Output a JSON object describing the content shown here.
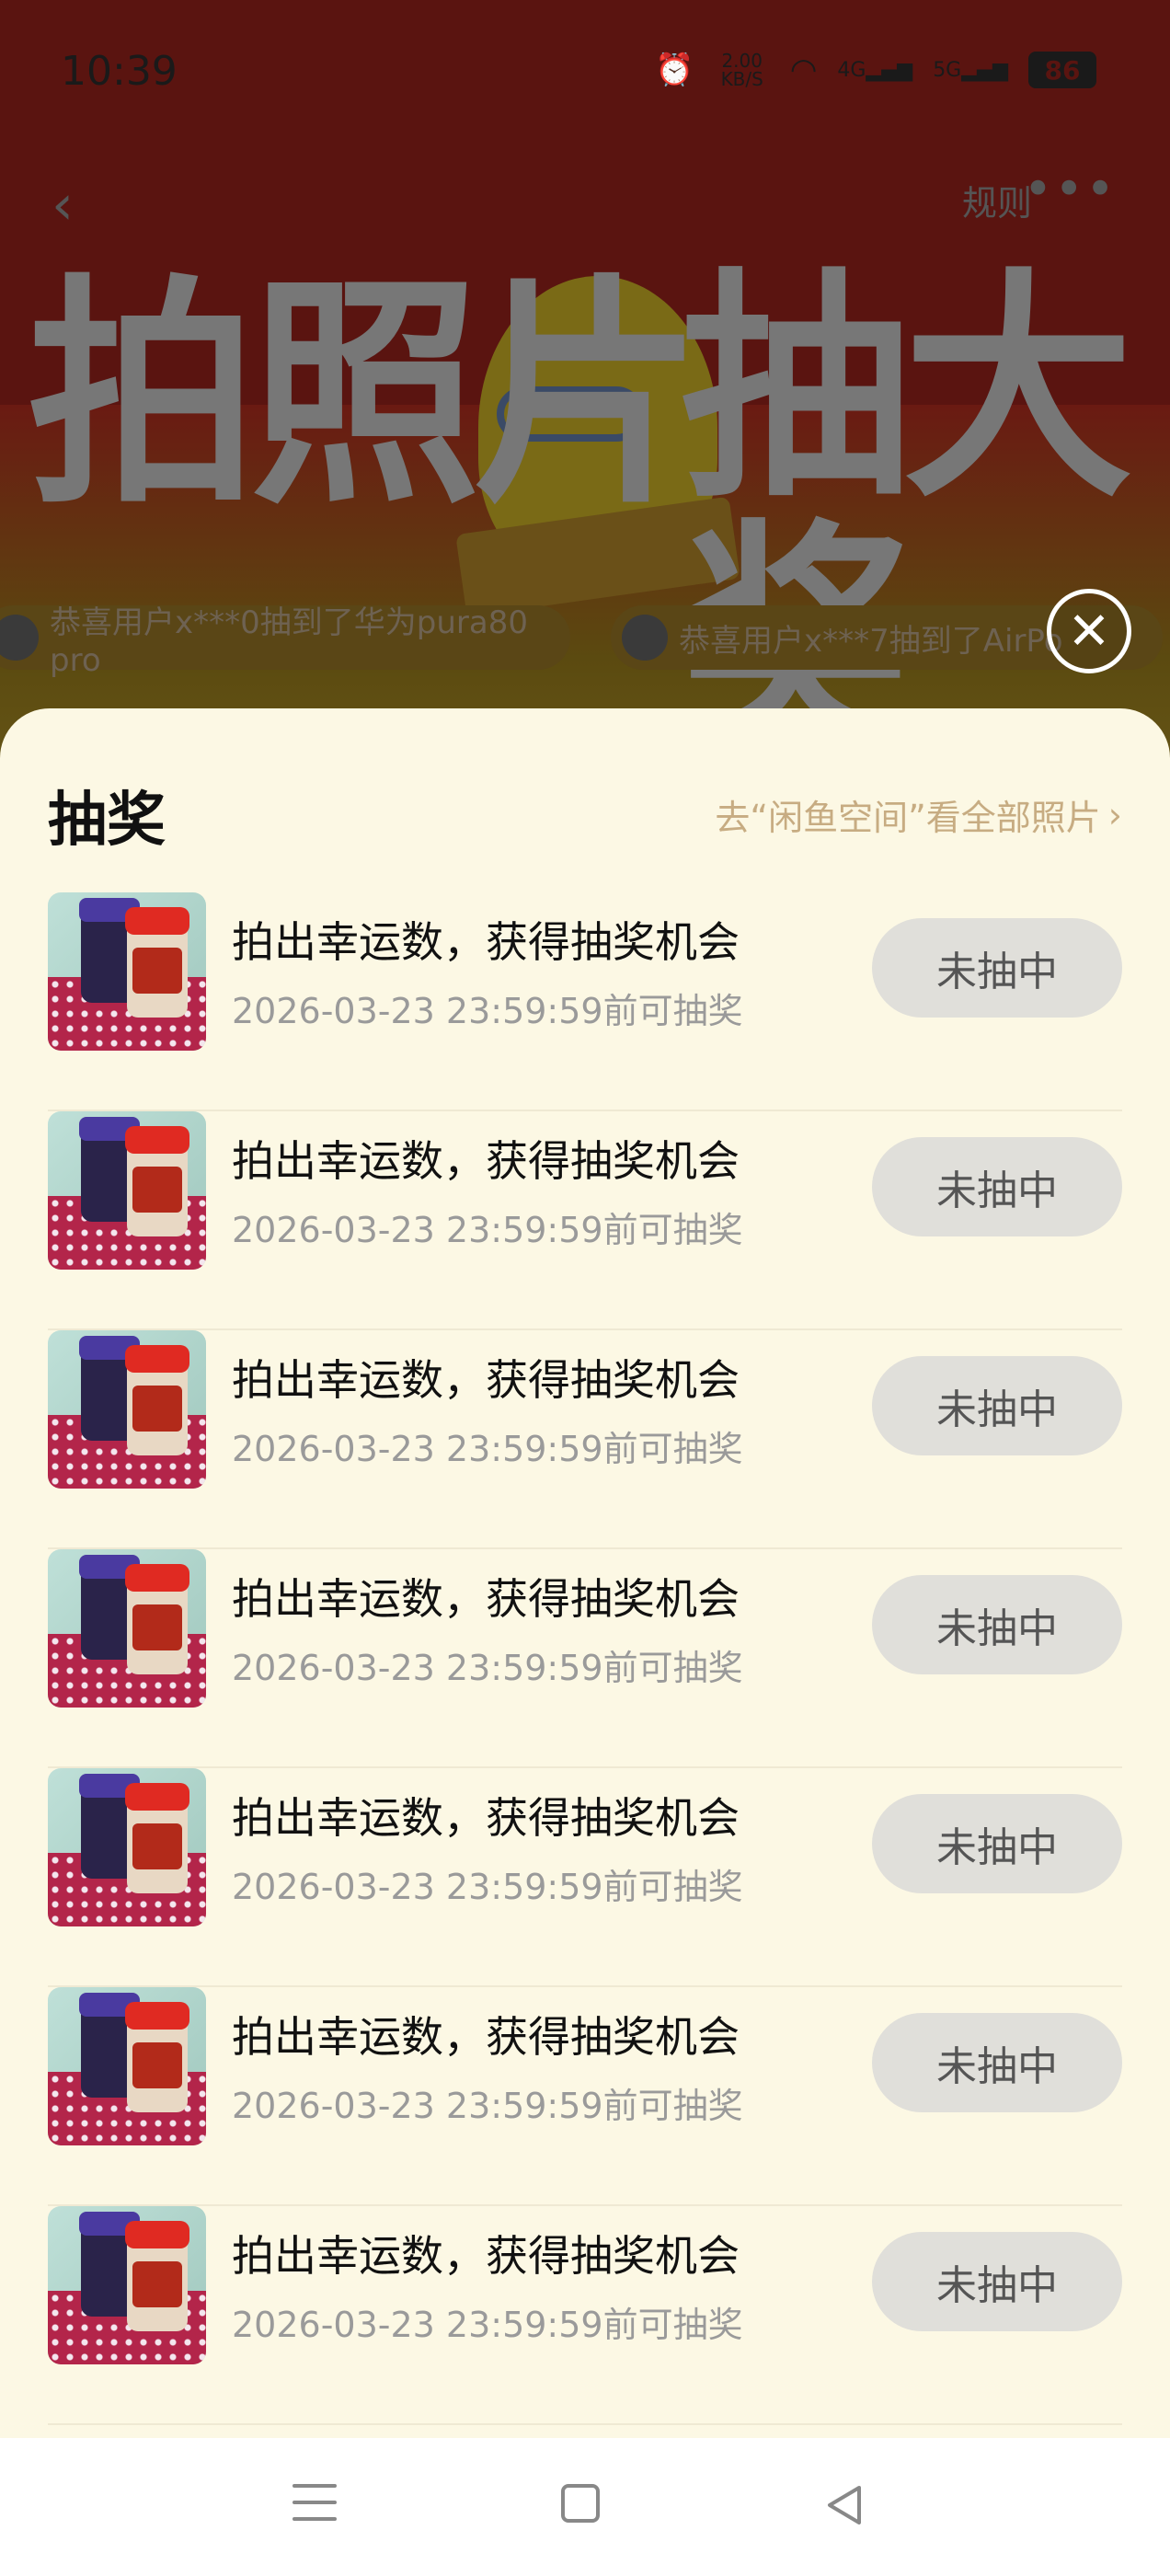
{
  "status_bar": {
    "time": "10:39",
    "net_speed": "2.00 KB/S",
    "sim1": "4G",
    "sim2": "5G",
    "battery": "86"
  },
  "top_nav": {
    "back_icon": "chevron-left-icon",
    "rules_label": "规则",
    "more_icon": "more-dots-icon"
  },
  "banner": {
    "headline_left": "拍照片",
    "headline_right": "抽大奖"
  },
  "ticker": [
    {
      "text": "恭喜用户x***0抽到了华为pura80 pro"
    },
    {
      "text": "恭喜用户x***7抽到了AirPo"
    }
  ],
  "sheet": {
    "title": "抽奖",
    "all_photos_link": "去“闲鱼空间”看全部照片",
    "rows": [
      {
        "title": "拍出幸运数，获得抽奖机会",
        "subtitle": "2026-03-23 23:59:59前可抽奖",
        "button": "未抽中"
      },
      {
        "title": "拍出幸运数，获得抽奖机会",
        "subtitle": "2026-03-23 23:59:59前可抽奖",
        "button": "未抽中"
      },
      {
        "title": "拍出幸运数，获得抽奖机会",
        "subtitle": "2026-03-23 23:59:59前可抽奖",
        "button": "未抽中"
      },
      {
        "title": "拍出幸运数，获得抽奖机会",
        "subtitle": "2026-03-23 23:59:59前可抽奖",
        "button": "未抽中"
      },
      {
        "title": "拍出幸运数，获得抽奖机会",
        "subtitle": "2026-03-23 23:59:59前可抽奖",
        "button": "未抽中"
      },
      {
        "title": "拍出幸运数，获得抽奖机会",
        "subtitle": "2026-03-23 23:59:59前可抽奖",
        "button": "未抽中"
      },
      {
        "title": "拍出幸运数，获得抽奖机会",
        "subtitle": "2026-03-23 23:59:59前可抽奖",
        "button": "未抽中"
      }
    ]
  },
  "colors": {
    "sheet_bg": "#fcf8e4",
    "link": "#c7ac82",
    "button_bg": "#e0dfda",
    "overlay_bg": "#5a1410"
  }
}
